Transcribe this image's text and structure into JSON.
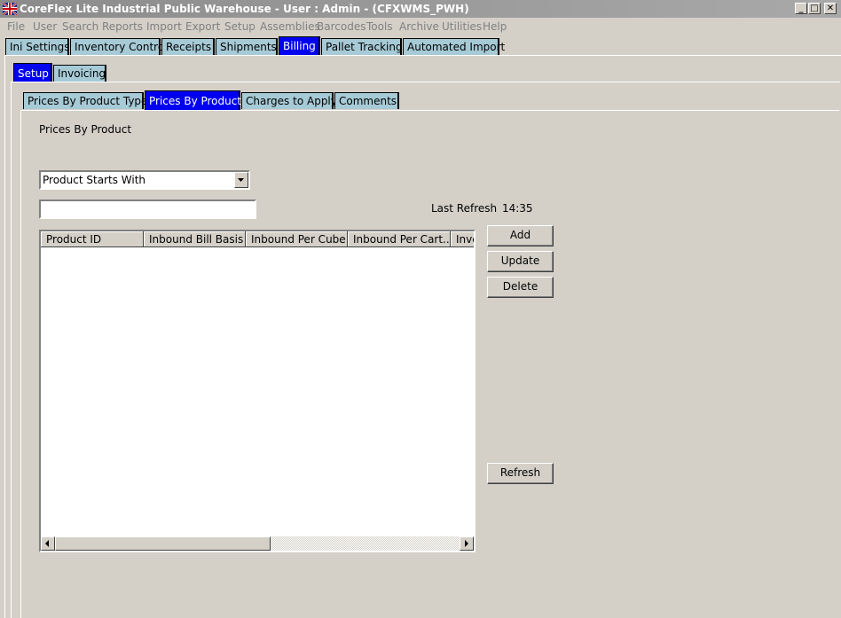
{
  "window": {
    "title": "CoreFlex Lite Industrial Public Warehouse - User : Admin - (CFXWMS_PWH)",
    "minimize": "_",
    "maximize": "□",
    "close": "✕"
  },
  "menu": [
    "File",
    "User",
    "Search",
    "Reports",
    "Import",
    "Export",
    "Setup",
    "Assemblies",
    "Barcodes",
    "Tools",
    "Archive",
    "Utilities",
    "Help"
  ],
  "main_tabs": [
    "Ini Settings",
    "Inventory Control",
    "Receipts",
    "Shipments",
    "Billing",
    "Pallet Tracking",
    "Automated Import"
  ],
  "main_tabs_active": "Billing",
  "sub_tabs": [
    "Setup",
    "Invoicing"
  ],
  "sub_tabs_active": "Setup",
  "inner_tabs": [
    "Prices By Product Type",
    "Prices By Product",
    "Charges to Apply",
    "Comments"
  ],
  "inner_tabs_active": "Prices By Product",
  "panel": {
    "heading": "Prices By Product",
    "filter_select": "Product Starts With",
    "filter_input": "",
    "last_refresh_label": "Last Refresh",
    "last_refresh_time": "14:35"
  },
  "table": {
    "columns": [
      "Product ID",
      "Inbound Bill Basis",
      "Inbound Per Cube",
      "Inbound Per Cart...",
      "Inve"
    ],
    "rows": []
  },
  "buttons": {
    "add": "Add",
    "update": "Update",
    "delete": "Delete",
    "refresh": "Refresh"
  },
  "colors": {
    "active_tab": "#0000f0",
    "inactive_tab": "#a6cad6",
    "window_bg": "#d4d0c8"
  }
}
